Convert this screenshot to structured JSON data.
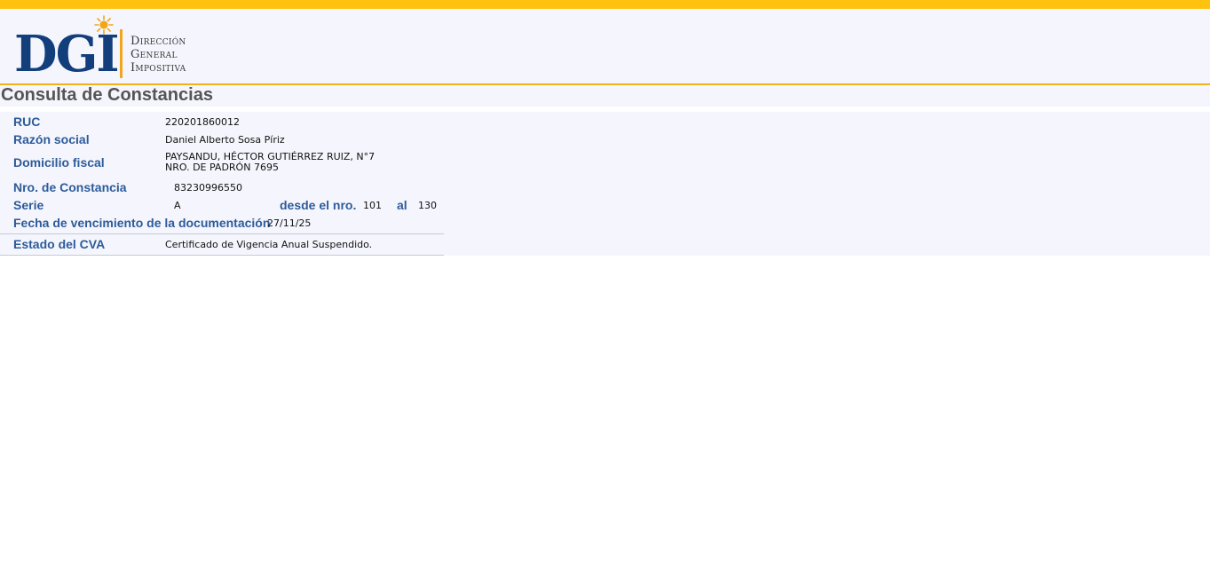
{
  "logo": {
    "brand": "DGI",
    "line1": "Dirección",
    "line2": "General",
    "line3": "Impositiva"
  },
  "page_title": "Consulta de Constancias",
  "fields": {
    "ruc": {
      "label": "RUC",
      "value": "220201860012"
    },
    "razon_social": {
      "label": "Razón social",
      "value": "Daniel Alberto Sosa Píriz"
    },
    "domicilio": {
      "label": "Domicilio fiscal",
      "line1": "PAYSANDU, HÉCTOR GUTIÉRREZ RUIZ, N°7",
      "line2": "NRO. DE PADRÓN 7695"
    },
    "constancia": {
      "label": "Nro. de Constancia",
      "value": "83230996550"
    },
    "serie": {
      "label": "Serie",
      "value": "A",
      "desde_label": "desde el nro.",
      "desde_value": "101",
      "al_label": "al",
      "al_value": "130"
    },
    "vencimiento": {
      "label": "Fecha de vencimiento de la documentación",
      "value": "27/11/25"
    },
    "estado": {
      "label": "Estado del CVA",
      "value": "Certificado de Vigencia Anual Suspendido."
    }
  },
  "colors": {
    "top_bar": "#ffc20e",
    "label_blue": "#2d5b9a",
    "brand_blue": "#133e7c",
    "accent_orange": "#f2a516"
  }
}
